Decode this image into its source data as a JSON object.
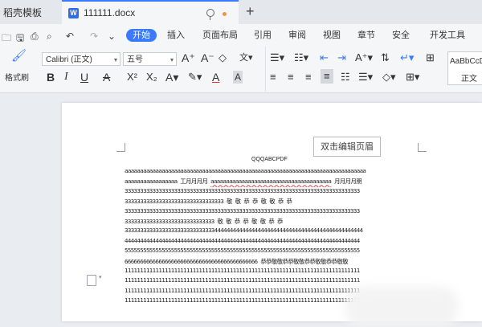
{
  "tabs": {
    "templates": "稻壳模板",
    "doc": "111111.docx",
    "new": "+"
  },
  "ribbon_tabs": [
    "开始",
    "插入",
    "页面布局",
    "引用",
    "审阅",
    "视图",
    "章节",
    "安全",
    "开发工具"
  ],
  "toolbar": {
    "format_painter": "格式刷",
    "font": "Calibri (正文)",
    "size": "五号",
    "style_preview": "AaBbCcD",
    "style_name": "正文"
  },
  "header_button": "双击编辑页眉",
  "page_header": "QQQABCPDF",
  "body": {
    "line1": "aaaaaaaaaaaaaaaaaaaaaaaaaaaaaaaaaaaaaaaaaaaaaaaaaaaaaaaaaaaaaaaaaaaaaaaaaaaaaa",
    "line2a": "aaaaaaaaaaaaaaaaa 工月月月月",
    "line2b": "aaaaaaaaaaaaaaaaaaaaaaaaaaaaaaaaaaaaaaa",
    "line2c": " 月月月月朋",
    "line3": "3333333333333333333333333333333333333333333333333333333333333333333333333333",
    "line4": "33333333333333333333333333333333  敬  敬  恭  恭  敬  敬  恭  恭",
    "line5": "3333333333333333333333333333333333333333333333333333333333333333333333333333",
    "line6": "33333333333333333333333333333  敬  敬  恭  恭  敬  敬  恭  恭",
    "line7": "33333333333333333333333333333444444444444444444444444444444444444444444444444",
    "line8": "4444444444444444444444444444444444444444444444444444444444444444444444444444",
    "line9": "5555555555555555555555555555555555555555555555555555555555555555555555555555",
    "line10": "6666666666666666666666666666666666666666666 恭恭敬敬恭恭敬敬恭恭敬敬恭恭敬敬",
    "line11": "1111111111111111111111111111111111111111111111111111111111111111111111111111",
    "line12": "1111111111111111111111111111111111111111111111111111111111111111111111111111",
    "line13": "1111111111111111111111111111111111111111111111111111111111111111111111111111",
    "line14": "1111111111111111111111111111111111111111111111111111111111111111111111111111"
  },
  "colors": {
    "accent": "#3a7afe",
    "modified_dot": "#f0953a",
    "spell_error": "#e04040"
  },
  "icons": [
    "open-folder-icon",
    "print-icon",
    "print-preview-icon",
    "undo-icon",
    "redo-icon",
    "more-icon",
    "clip-icon",
    "dot-icon",
    "format-painter-icon",
    "grow-font-icon",
    "shrink-font-icon",
    "clear-format-icon",
    "phonetic-icon",
    "bold-icon",
    "italic-icon",
    "underline-icon",
    "strikethrough-icon",
    "superscript-icon",
    "subscript-icon",
    "text-effect-icon",
    "highlight-icon",
    "font-color-icon",
    "char-shading-icon",
    "bullets-icon",
    "numbering-icon",
    "decrease-indent-icon",
    "increase-indent-icon",
    "text-direction-icon",
    "sort-icon",
    "show-marks-icon",
    "align-left-icon",
    "align-center-icon",
    "align-right-icon",
    "justify-icon",
    "distribute-icon",
    "line-spacing-icon",
    "shading-icon",
    "borders-icon",
    "file-icon"
  ]
}
